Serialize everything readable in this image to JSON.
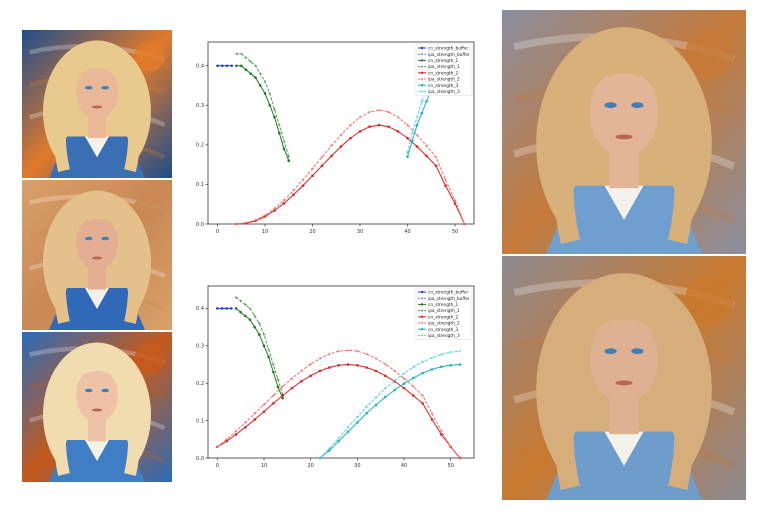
{
  "images": [
    {
      "id": "thumb1",
      "palette": {
        "bg1": "#1e4d8c",
        "bg2": "#e07a2a",
        "hair": "#e8c98e",
        "skin": "#e8b899",
        "cloth": "#3a6fb3"
      }
    },
    {
      "id": "thumb2",
      "palette": {
        "bg1": "#d9a06a",
        "bg2": "#c98855",
        "hair": "#e4c08a",
        "skin": "#e3ae91",
        "cloth": "#2f69b8"
      }
    },
    {
      "id": "thumb3",
      "palette": {
        "bg1": "#2a6cb8",
        "bg2": "#c55a1c",
        "hair": "#f0dcae",
        "skin": "#edc2a6",
        "cloth": "#3f7ec4"
      }
    },
    {
      "id": "big1",
      "palette": {
        "bg1": "#8a8ea0",
        "bg2": "#c57a3a",
        "hair": "#d8b07a",
        "skin": "#e2b596",
        "cloth": "#6f9fcf"
      }
    },
    {
      "id": "big2",
      "palette": {
        "bg1": "#8d8a92",
        "bg2": "#c9792f",
        "hair": "#d5ae7c",
        "skin": "#deb193",
        "cloth": "#6e9dcb"
      }
    }
  ],
  "chart_data": [
    {
      "type": "line",
      "xlim": [
        -2,
        54
      ],
      "ylim": [
        0,
        0.46
      ],
      "xticks": [
        0,
        10,
        20,
        30,
        40,
        50
      ],
      "yticks": [
        0.0,
        0.1,
        0.2,
        0.3,
        0.4
      ],
      "grid": false,
      "legend_position": "top-right",
      "series": [
        {
          "name": "cn_strength_buffer",
          "color": "#1f3fd9",
          "dashed": false,
          "x": [
            0,
            1,
            2,
            3
          ],
          "y": [
            0.4,
            0.4,
            0.4,
            0.4
          ]
        },
        {
          "name": "ipa_strength_buffer",
          "color": "#6f7fe8",
          "dashed": true,
          "x": [],
          "y": []
        },
        {
          "name": "cn_strength_1",
          "color": "#1f7a1f",
          "dashed": false,
          "x": [
            4,
            5,
            6,
            7,
            8,
            9,
            10,
            11,
            12,
            13,
            14,
            15
          ],
          "y": [
            0.4,
            0.4,
            0.39,
            0.38,
            0.37,
            0.35,
            0.33,
            0.3,
            0.27,
            0.23,
            0.19,
            0.16
          ]
        },
        {
          "name": "ipa_strength_1",
          "color": "#4f9a4f",
          "dashed": true,
          "x": [
            4,
            5,
            6,
            7,
            8,
            9,
            10,
            11,
            12,
            13,
            14,
            15
          ],
          "y": [
            0.43,
            0.43,
            0.42,
            0.41,
            0.4,
            0.38,
            0.36,
            0.33,
            0.29,
            0.25,
            0.21,
            0.17
          ]
        },
        {
          "name": "cn_strength_2",
          "color": "#e02020",
          "dashed": false,
          "x": [
            4,
            6,
            8,
            10,
            12,
            14,
            16,
            18,
            20,
            22,
            24,
            26,
            28,
            30,
            32,
            34,
            36,
            38,
            40,
            42,
            44,
            46,
            48,
            50,
            52
          ],
          "y": [
            0.0,
            0.002,
            0.008,
            0.019,
            0.034,
            0.052,
            0.074,
            0.097,
            0.122,
            0.147,
            0.172,
            0.196,
            0.217,
            0.234,
            0.246,
            0.25,
            0.246,
            0.234,
            0.217,
            0.196,
            0.172,
            0.147,
            0.097,
            0.052,
            0.0
          ]
        },
        {
          "name": "ipa_strength_2",
          "color": "#f07070",
          "dashed": true,
          "x": [
            4,
            6,
            8,
            10,
            12,
            14,
            16,
            18,
            20,
            22,
            24,
            26,
            28,
            30,
            32,
            34,
            36,
            38,
            40,
            42,
            44,
            46,
            48,
            50,
            52
          ],
          "y": [
            0.0,
            0.003,
            0.01,
            0.022,
            0.039,
            0.06,
            0.085,
            0.112,
            0.14,
            0.169,
            0.198,
            0.225,
            0.25,
            0.27,
            0.283,
            0.288,
            0.283,
            0.27,
            0.25,
            0.225,
            0.198,
            0.169,
            0.112,
            0.06,
            0.0
          ]
        },
        {
          "name": "cn_strength_3",
          "color": "#1fb0c0",
          "dashed": false,
          "x": [
            40,
            41,
            42,
            43,
            44,
            45,
            46,
            47,
            48,
            49,
            50,
            51
          ],
          "y": [
            0.17,
            0.21,
            0.25,
            0.28,
            0.31,
            0.34,
            0.36,
            0.37,
            0.38,
            0.39,
            0.4,
            0.4
          ]
        },
        {
          "name": "ipa_strength_3",
          "color": "#56d0dc",
          "dashed": true,
          "x": [
            40,
            41,
            42,
            43,
            44,
            45,
            46,
            47,
            48,
            49,
            50,
            51
          ],
          "y": [
            0.18,
            0.23,
            0.27,
            0.31,
            0.34,
            0.37,
            0.39,
            0.4,
            0.41,
            0.42,
            0.43,
            0.43
          ]
        }
      ]
    },
    {
      "type": "line",
      "xlim": [
        -2,
        55
      ],
      "ylim": [
        0,
        0.46
      ],
      "xticks": [
        0,
        10,
        20,
        30,
        40,
        50
      ],
      "yticks": [
        0.0,
        0.1,
        0.2,
        0.3,
        0.4
      ],
      "grid": false,
      "legend_position": "top-right",
      "series": [
        {
          "name": "cn_strength_buffer",
          "color": "#1f3fd9",
          "dashed": false,
          "x": [
            0,
            1,
            2,
            3
          ],
          "y": [
            0.4,
            0.4,
            0.4,
            0.4
          ]
        },
        {
          "name": "ipa_strength_buffer",
          "color": "#6f7fe8",
          "dashed": true,
          "x": [],
          "y": []
        },
        {
          "name": "cn_strength_1",
          "color": "#1f7a1f",
          "dashed": false,
          "x": [
            4,
            5,
            6,
            7,
            8,
            9,
            10,
            11,
            12,
            13,
            14
          ],
          "y": [
            0.4,
            0.39,
            0.38,
            0.37,
            0.35,
            0.33,
            0.3,
            0.27,
            0.23,
            0.19,
            0.16
          ]
        },
        {
          "name": "ipa_strength_1",
          "color": "#4f9a4f",
          "dashed": true,
          "x": [
            4,
            5,
            6,
            7,
            8,
            9,
            10,
            11,
            12,
            13,
            14
          ],
          "y": [
            0.43,
            0.42,
            0.41,
            0.4,
            0.38,
            0.36,
            0.33,
            0.29,
            0.25,
            0.21,
            0.17
          ]
        },
        {
          "name": "cn_strength_2",
          "color": "#e02020",
          "dashed": false,
          "x": [
            0,
            2,
            4,
            6,
            8,
            10,
            12,
            14,
            16,
            18,
            20,
            22,
            24,
            26,
            28,
            30,
            32,
            34,
            36,
            38,
            40,
            42,
            44,
            46,
            48,
            50,
            52
          ],
          "y": [
            0.03,
            0.045,
            0.063,
            0.082,
            0.103,
            0.124,
            0.146,
            0.167,
            0.187,
            0.205,
            0.22,
            0.233,
            0.242,
            0.248,
            0.25,
            0.248,
            0.242,
            0.233,
            0.22,
            0.205,
            0.187,
            0.167,
            0.146,
            0.103,
            0.063,
            0.03,
            0.0
          ]
        },
        {
          "name": "ipa_strength_2",
          "color": "#f07070",
          "dashed": true,
          "x": [
            0,
            2,
            4,
            6,
            8,
            10,
            12,
            14,
            16,
            18,
            20,
            22,
            24,
            26,
            28,
            30,
            32,
            34,
            36,
            38,
            40,
            42,
            44,
            46,
            48,
            50,
            52
          ],
          "y": [
            0.03,
            0.05,
            0.072,
            0.095,
            0.119,
            0.143,
            0.167,
            0.191,
            0.213,
            0.233,
            0.251,
            0.266,
            0.278,
            0.286,
            0.288,
            0.286,
            0.278,
            0.266,
            0.251,
            0.233,
            0.213,
            0.191,
            0.167,
            0.119,
            0.072,
            0.03,
            0.0
          ]
        },
        {
          "name": "cn_strength_3",
          "color": "#1fb0c0",
          "dashed": false,
          "x": [
            22,
            24,
            26,
            28,
            30,
            32,
            34,
            36,
            38,
            40,
            42,
            44,
            46,
            48,
            50,
            52
          ],
          "y": [
            0.0,
            0.02,
            0.045,
            0.07,
            0.095,
            0.12,
            0.142,
            0.163,
            0.182,
            0.199,
            0.214,
            0.227,
            0.237,
            0.244,
            0.248,
            0.25
          ]
        },
        {
          "name": "ipa_strength_3",
          "color": "#56d0dc",
          "dashed": true,
          "x": [
            22,
            24,
            26,
            28,
            30,
            32,
            34,
            36,
            38,
            40,
            42,
            44,
            46,
            48,
            50,
            52
          ],
          "y": [
            0.0,
            0.025,
            0.053,
            0.082,
            0.11,
            0.137,
            0.162,
            0.186,
            0.207,
            0.226,
            0.243,
            0.257,
            0.268,
            0.277,
            0.283,
            0.286
          ]
        }
      ]
    }
  ]
}
